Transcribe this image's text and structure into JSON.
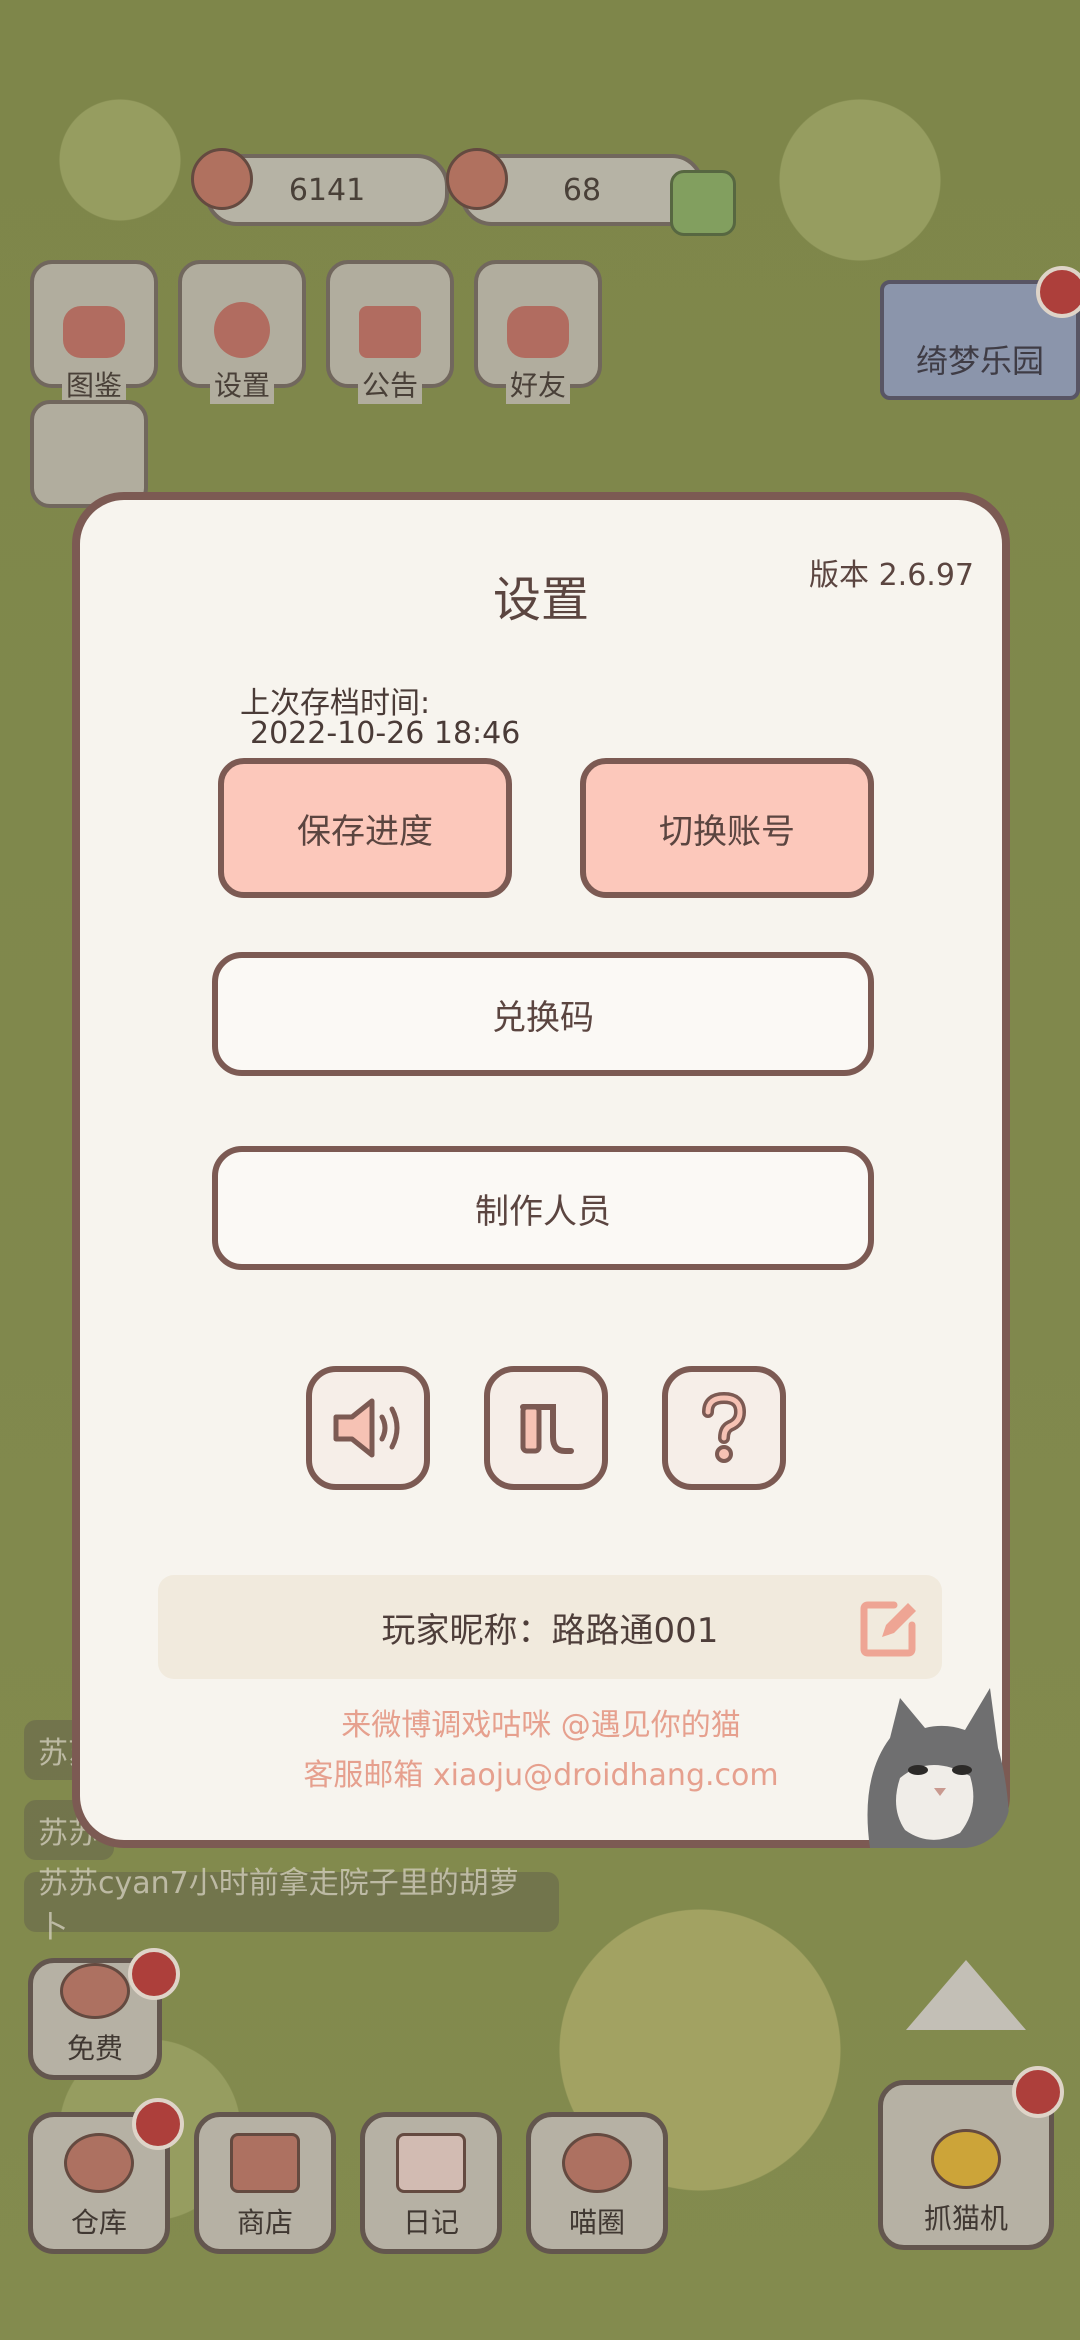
{
  "resources": {
    "coins": "6141",
    "tomatoes": "68"
  },
  "top_menu": [
    {
      "label": "图鉴",
      "icon": "catalog-icon"
    },
    {
      "label": "设置",
      "icon": "gear-icon"
    },
    {
      "label": "公告",
      "icon": "gift-icon"
    },
    {
      "label": "好友",
      "icon": "friends-icon"
    }
  ],
  "park_label": "绮梦乐园",
  "ticker": [
    "苏苏",
    "苏苏",
    "苏苏cyan7小时前拿走院子里的胡萝卜"
  ],
  "dialog": {
    "title": "设置",
    "version": "版本 2.6.97",
    "save_time_label": "上次存档时间:",
    "save_time_value": "2022-10-26 18:46",
    "save_button": "保存进度",
    "switch_account_button": "切换账号",
    "redeem_code_button": "兑换码",
    "credits_button": "制作人员",
    "icons": [
      "sound-icon",
      "music-icon",
      "help-icon"
    ],
    "nickname": "玩家昵称：路路通001",
    "footer_weibo": "来微博调戏咕咪 @遇见你的猫",
    "footer_email": "客服邮箱 xiaoju@droidhang.com"
  },
  "bottom_bar": {
    "free": "免费",
    "warehouse": "仓库",
    "shop": "商店",
    "diary": "日记",
    "cat_circle": "喵圈",
    "claw_machine": "抓猫机"
  },
  "colors": {
    "dialog_bg": "#f7f4ee",
    "dialog_border": "#7c5a53",
    "pink_button": "#fcc8bb",
    "footer_text": "#e6a08e",
    "nickname_bg": "#f1eadd"
  }
}
